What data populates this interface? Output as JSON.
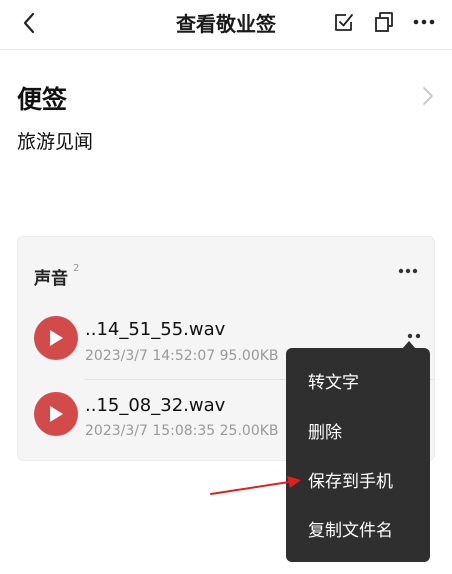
{
  "header": {
    "title": "查看敬业签",
    "icons": [
      "back-icon",
      "check-square-icon",
      "copy-icon",
      "more-icon"
    ]
  },
  "note": {
    "category": "便签",
    "content": "旅游见闻"
  },
  "audio_card": {
    "title": "声音",
    "count": "2",
    "items": [
      {
        "name": "..14_51_55.wav",
        "meta": "2023/3/7 14:52:07 95.00KB"
      },
      {
        "name": "..15_08_32.wav",
        "meta": "2023/3/7 15:08:35 25.00KB"
      }
    ]
  },
  "menu": {
    "items": [
      "转文字",
      "删除",
      "保存到手机",
      "复制文件名"
    ]
  },
  "colors": {
    "play_button": "#d24a4a",
    "menu_background": "#2f2f2f",
    "annotation_arrow": "#e02020"
  }
}
